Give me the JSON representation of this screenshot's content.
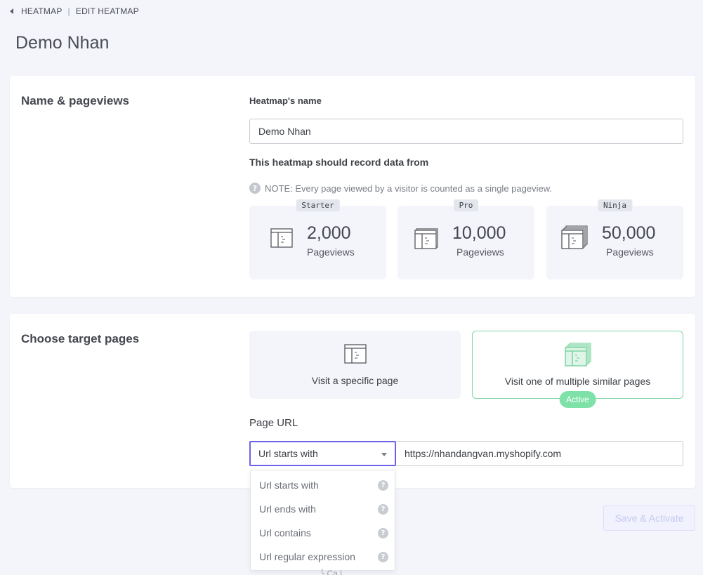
{
  "breadcrumb": {
    "parent": "HEATMAP",
    "separator": "|",
    "current": "EDIT HEATMAP"
  },
  "page_title": "Demo Nhan",
  "name_section": {
    "title": "Name & pageviews",
    "name_label": "Heatmap's name",
    "name_value": "Demo Nhan",
    "record_label": "This heatmap should record data from",
    "note": "NOTE: Every page viewed by a visitor is counted as a single pageview.",
    "plans": [
      {
        "badge": "Starter",
        "number": "2,000",
        "unit": "Pageviews",
        "icon": "single-page-icon"
      },
      {
        "badge": "Pro",
        "number": "10,000",
        "unit": "Pageviews",
        "icon": "double-page-icon"
      },
      {
        "badge": "Ninja",
        "number": "50,000",
        "unit": "Pageviews",
        "icon": "stacked-pages-icon"
      }
    ]
  },
  "target_section": {
    "title": "Choose target pages",
    "options": [
      {
        "label": "Visit a specific page",
        "active": false
      },
      {
        "label": "Visit one of multiple similar pages",
        "active": true
      }
    ],
    "active_badge": "Active",
    "url_label": "Page URL",
    "match_selected": "Url starts with",
    "url_value": "https://nhandangvan.myshopify.com",
    "match_options": [
      "Url starts with",
      "Url ends with",
      "Url contains",
      "Url regular expression"
    ]
  },
  "actions": {
    "save_label": "Save & Activate"
  },
  "partial_bottom_text": "╰ Ca.l..",
  "colors": {
    "accent": "#6c62e8",
    "active_green": "#7ee2a8",
    "background": "#f4f5fa"
  }
}
